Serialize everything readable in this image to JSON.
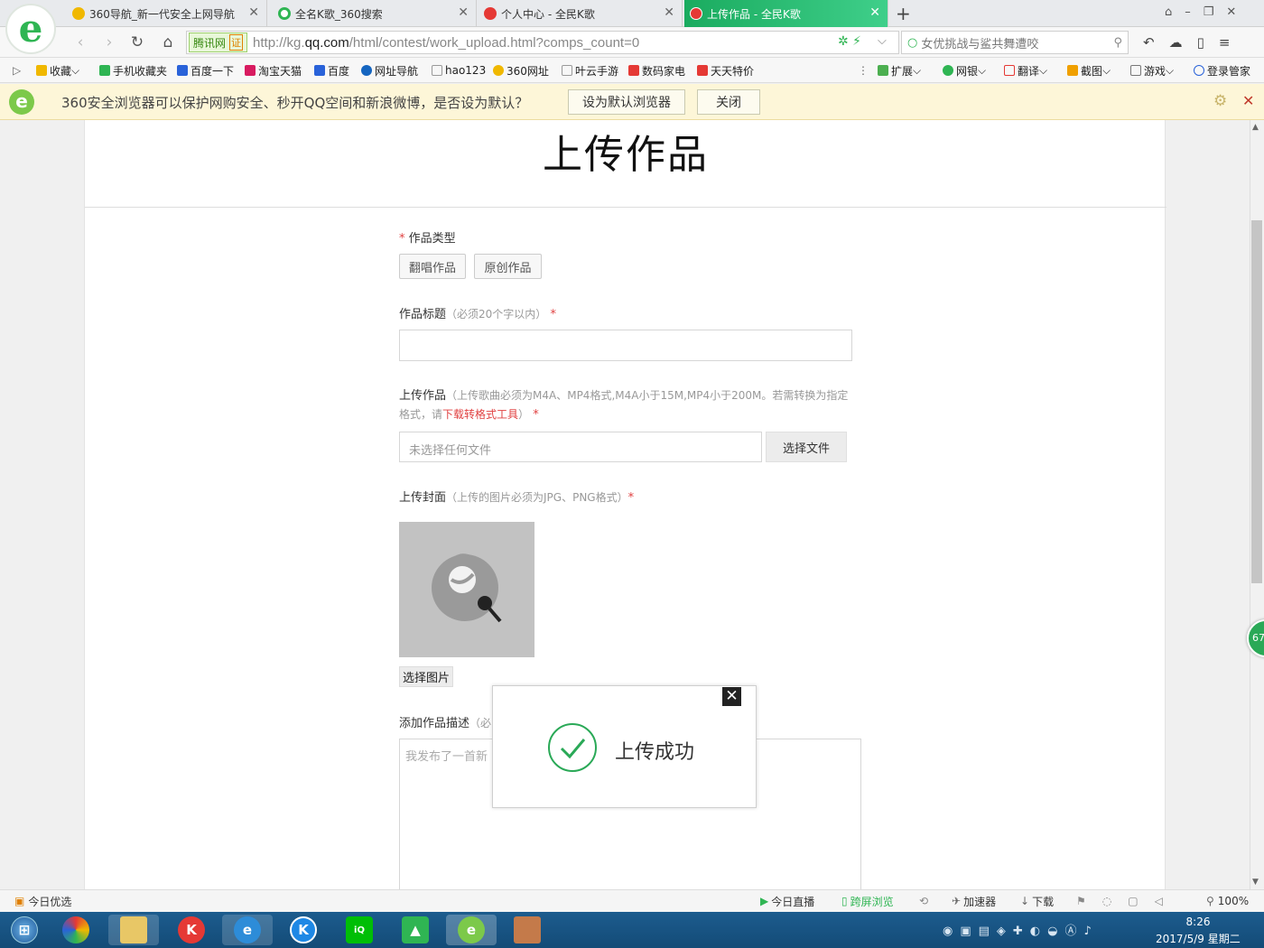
{
  "tabs": [
    {
      "label": "360导航_新一代安全上网导航",
      "icon_color": "#f0b800"
    },
    {
      "label": "全名K歌_360搜索",
      "icon_color": "#2fb553"
    },
    {
      "label": "个人中心 - 全民K歌",
      "icon_color": "#e53935"
    },
    {
      "label": "上传作品 - 全民K歌",
      "icon_color": "#e53935"
    }
  ],
  "new_tab": "+",
  "address": {
    "badge": "腾讯网",
    "badge_cert": "证",
    "url_prefix": "http://kg.",
    "url_host": "qq.com",
    "url_path": "/html/contest/work_upload.html?comps_count=0",
    "search_text": "女优挑战与鲨共舞遭咬"
  },
  "bookmarks": [
    {
      "label": "收藏",
      "color": "#f0b800"
    },
    {
      "label": "手机收藏夹",
      "color": "#2fb553"
    },
    {
      "label": "百度一下",
      "color": "#2962d9"
    },
    {
      "label": "淘宝天猫",
      "color": "#d81b60"
    },
    {
      "label": "百度",
      "color": "#2962d9"
    },
    {
      "label": "网址导航",
      "color": "#1565c0"
    },
    {
      "label": "hao123",
      "color": "#999999"
    },
    {
      "label": "360网址",
      "color": "#f0b800"
    },
    {
      "label": "叶云手游",
      "color": "#999999"
    },
    {
      "label": "数码家电",
      "color": "#e53935"
    },
    {
      "label": "天天特价",
      "color": "#e53935"
    }
  ],
  "toolbar_right": [
    {
      "label": "扩展"
    },
    {
      "label": "网银"
    },
    {
      "label": "翻译"
    },
    {
      "label": "截图"
    },
    {
      "label": "游戏"
    },
    {
      "label": "登录管家"
    }
  ],
  "notice": {
    "text": "360安全浏览器可以保护网购安全、秒开QQ空间和新浪微博，是否设为默认？",
    "set_default": "设为默认浏览器",
    "close": "关闭"
  },
  "page": {
    "title": "上传作品",
    "type_label": "作品类型",
    "type_options": [
      "翻唱作品",
      "原创作品"
    ],
    "title_field_label": "作品标题",
    "title_field_hint": "（必须20个字以内）",
    "upload_label": "上传作品",
    "upload_hint_1": "（上传歌曲必须为M4A、MP4格式,M4A小于15M,MP4小于200M。若需转换为指",
    "upload_hint_2": "定格式，请",
    "upload_hint_link": "下载转格式工具",
    "upload_hint_3": "）",
    "file_placeholder": "未选择任何文件",
    "choose_file": "选择文件",
    "cover_label": "上传封面",
    "cover_hint": "（上传的图片必须为JPG、PNG格式）",
    "choose_image": "选择图片",
    "desc_label": "添加作品描述",
    "desc_hint": "（必",
    "desc_placeholder": "我发布了一首新",
    "required_mark": "*"
  },
  "modal": {
    "message": "上传成功",
    "close": "✕"
  },
  "side_badge": "67",
  "statusbar": {
    "left": "今日优选",
    "items": [
      "今日直播",
      "跨屏浏览",
      "加速器",
      "下载"
    ],
    "zoom": "100%"
  },
  "taskbar": {
    "time": "8:26",
    "date": "2017/5/9 星期二"
  }
}
